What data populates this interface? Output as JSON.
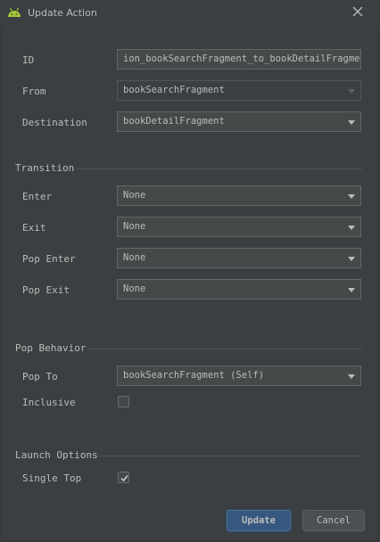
{
  "window": {
    "title": "Update Action",
    "app_icon": "android-icon",
    "close_icon": "close-icon"
  },
  "form": {
    "id": {
      "label": "ID",
      "value": "ion_bookSearchFragment_to_bookDetailFragment"
    },
    "from": {
      "label": "From",
      "value": "bookSearchFragment"
    },
    "destination": {
      "label": "Destination",
      "value": "bookDetailFragment"
    }
  },
  "transition": {
    "heading": "Transition",
    "enter": {
      "label": "Enter",
      "value": "None"
    },
    "exit": {
      "label": "Exit",
      "value": "None"
    },
    "pop_enter": {
      "label": "Pop Enter",
      "value": "None"
    },
    "pop_exit": {
      "label": "Pop Exit",
      "value": "None"
    }
  },
  "pop_behavior": {
    "heading": "Pop Behavior",
    "pop_to": {
      "label": "Pop To",
      "value": "bookSearchFragment (Self)"
    },
    "inclusive": {
      "label": "Inclusive",
      "checked": false
    }
  },
  "launch_options": {
    "heading": "Launch Options",
    "single_top": {
      "label": "Single Top",
      "checked": true
    }
  },
  "buttons": {
    "update": "Update",
    "cancel": "Cancel"
  },
  "colors": {
    "background": "#3c3f41",
    "field": "#45494a",
    "primary_button": "#365880"
  }
}
